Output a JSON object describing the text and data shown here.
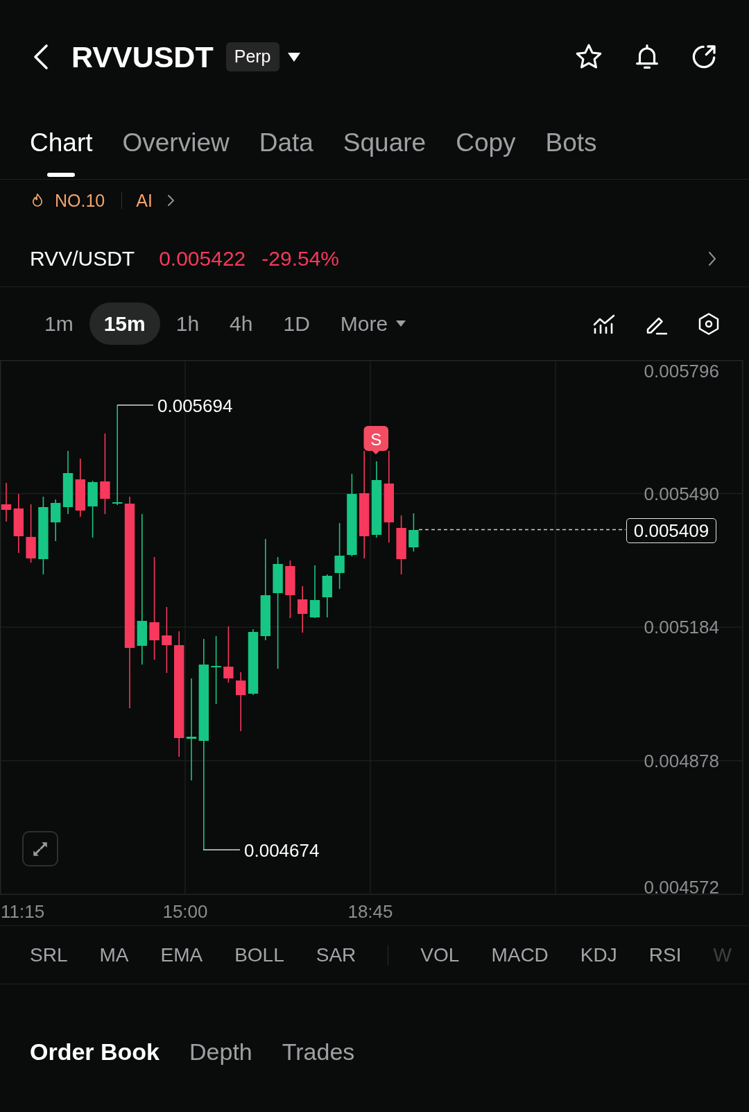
{
  "header": {
    "title": "RVVUSDT",
    "contract_type": "Perp"
  },
  "tabs": [
    {
      "label": "Chart",
      "selected": true
    },
    {
      "label": "Overview",
      "selected": false
    },
    {
      "label": "Data",
      "selected": false
    },
    {
      "label": "Square",
      "selected": false
    },
    {
      "label": "Copy",
      "selected": false
    },
    {
      "label": "Bots",
      "selected": false
    }
  ],
  "highlights": [
    {
      "kind": "rank",
      "label": "NO.10"
    },
    {
      "kind": "ai",
      "label": "AI"
    }
  ],
  "ticker": {
    "pair": "RVV/USDT",
    "price": "0.005422",
    "change": "-29.54%",
    "falling": true
  },
  "intervals": [
    {
      "label": "1m",
      "selected": false,
      "kind": "interval"
    },
    {
      "label": "15m",
      "selected": true,
      "kind": "interval"
    },
    {
      "label": "1h",
      "selected": false,
      "kind": "interval"
    },
    {
      "label": "4h",
      "selected": false,
      "kind": "interval"
    },
    {
      "label": "1D",
      "selected": false,
      "kind": "interval"
    },
    {
      "label": "More",
      "selected": false,
      "kind": "menu"
    }
  ],
  "chart": {
    "price_axis": [
      "0.005796",
      "0.005490",
      "0.005184",
      "0.004878",
      "0.004572"
    ],
    "time_axis": [
      "11:15",
      "15:00",
      "18:45"
    ],
    "high_label": "0.005694",
    "low_label": "0.004674",
    "last_price": "0.005409",
    "signal": "S"
  },
  "indicators": {
    "main": [
      "SRL",
      "MA",
      "EMA",
      "BOLL",
      "SAR"
    ],
    "sub": [
      "VOL",
      "MACD",
      "KDJ",
      "RSI",
      "W"
    ]
  },
  "book_tabs": [
    {
      "label": "Order Book",
      "selected": true
    },
    {
      "label": "Depth",
      "selected": false
    },
    {
      "label": "Trades",
      "selected": false
    }
  ]
}
